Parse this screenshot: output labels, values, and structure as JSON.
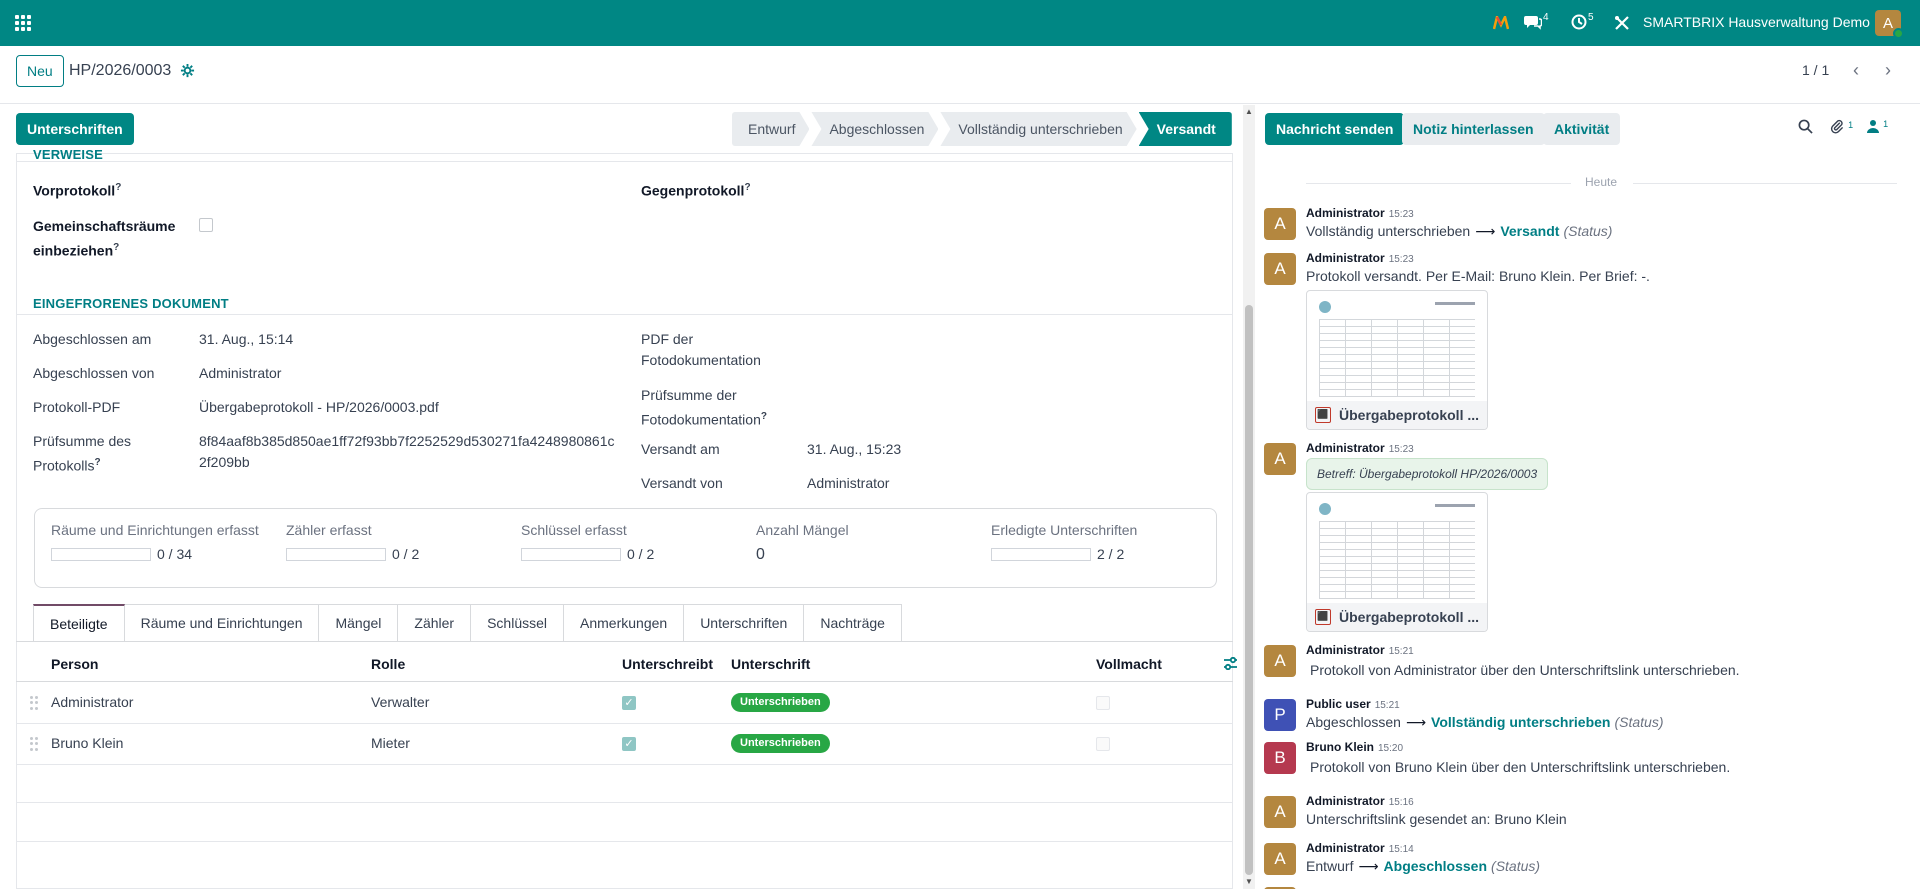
{
  "navbar": {
    "chat_count": "4",
    "activity_count": "5",
    "company": "SMARTBRIX Hausverwaltung Demo",
    "user_initial": "A"
  },
  "control_panel": {
    "new_label": "Neu",
    "record_name": "HP/2026/0003",
    "pager": "1 / 1"
  },
  "statusbar": {
    "action_label": "Unterschriften",
    "stages": [
      "Entwurf",
      "Abgeschlossen",
      "Vollständig unterschrieben",
      "Versandt"
    ],
    "active_stage": "Versandt"
  },
  "verweise": {
    "section_title": "VERWEISE",
    "vorprotokoll_label": "Vorprotokoll",
    "gegenprotokoll_label": "Gegenprotokoll",
    "gemeinschaft_label_1": "Gemeinschaftsräume",
    "gemeinschaft_label_2": "einbeziehen",
    "help_mark": "?"
  },
  "frozen": {
    "section_title": "EINGEFRORENES DOKUMENT",
    "abgeschlossen_am_label": "Abgeschlossen am",
    "abgeschlossen_am_value": "31. Aug., 15:14",
    "abgeschlossen_von_label": "Abgeschlossen von",
    "abgeschlossen_von_value": "Administrator",
    "protokoll_pdf_label": "Protokoll-PDF",
    "protokoll_pdf_value": "Übergabeprotokoll - HP/2026/0003.pdf",
    "pruefsumme_label_1": "Prüfsumme des",
    "pruefsumme_label_2": "Protokolls",
    "pruefsumme_value_1": "8f84aaf8b385d850ae1ff72f93bb7f2252529d530271fa4248980861c",
    "pruefsumme_value_2": "2f209bb",
    "pdf_foto_label_1": "PDF der",
    "pdf_foto_label_2": "Fotodokumentation",
    "pruef_foto_label_1": "Prüfsumme der",
    "pruef_foto_label_2": "Fotodokumentation",
    "versandt_am_label": "Versandt am",
    "versandt_am_value": "31. Aug., 15:23",
    "versandt_von_label": "Versandt von",
    "versandt_von_value": "Administrator"
  },
  "stats": [
    {
      "label": "Räume und Einrichtungen erfasst",
      "text": "0 / 34",
      "progress": 0
    },
    {
      "label": "Zähler erfasst",
      "text": "0 / 2",
      "progress": 0
    },
    {
      "label": "Schlüssel erfasst",
      "text": "0 / 2",
      "progress": 0
    },
    {
      "label": "Anzahl Mängel",
      "text": "0"
    },
    {
      "label": "Erledigte Unterschriften",
      "text": "2 / 2",
      "progress": 0
    }
  ],
  "tabs": [
    "Beteiligte",
    "Räume und Einrichtungen",
    "Mängel",
    "Zähler",
    "Schlüssel",
    "Anmerkungen",
    "Unterschriften",
    "Nachträge"
  ],
  "table": {
    "headers": [
      "Person",
      "Rolle",
      "Unterschreibt",
      "Unterschrift",
      "Vollmacht"
    ],
    "rows": [
      {
        "person": "Administrator",
        "rolle": "Verwalter",
        "unterschreibt": true,
        "unterschrift": "Unterschrieben",
        "vollmacht": false
      },
      {
        "person": "Bruno Klein",
        "rolle": "Mieter",
        "unterschreibt": true,
        "unterschrift": "Unterschrieben",
        "vollmacht": false
      }
    ]
  },
  "chatter": {
    "send_label": "Nachricht senden",
    "note_label": "Notiz hinterlassen",
    "activity_label": "Aktivität",
    "attachments_count": "1",
    "followers_count": "1",
    "today_label": "Heute",
    "messages": [
      {
        "initial": "A",
        "author": "Administrator",
        "time": "15:23",
        "old": "Vollständig unterschrieben",
        "arrow": "⟶",
        "new": "Versandt",
        "field": "(Status)",
        "color": "#b4873f"
      },
      {
        "initial": "A",
        "author": "Administrator",
        "time": "15:23",
        "text": "Protokoll versandt. Per E-Mail: Bruno Klein. Per Brief: -.",
        "attachment": "Übergabeprotokoll ...",
        "color": "#b4873f"
      },
      {
        "initial": "A",
        "author": "Administrator",
        "time": "15:23",
        "email": "Betreff: Übergabeprotokoll HP/2026/0003",
        "attachment": "Übergabeprotokoll ...",
        "color": "#b4873f"
      },
      {
        "initial": "A",
        "author": "Administrator",
        "time": "15:21",
        "text": "Protokoll von Administrator über den Unterschriftslink unterschrieben.",
        "color": "#b4873f"
      },
      {
        "initial": "P",
        "author": "Public user",
        "time": "15:21",
        "old": "Abgeschlossen",
        "arrow": "⟶",
        "new": "Vollständig unterschrieben",
        "field": "(Status)",
        "color": "#3f51b5"
      },
      {
        "initial": "B",
        "author": "Bruno Klein",
        "time": "15:20",
        "text": "Protokoll von Bruno Klein über den Unterschriftslink unterschrieben.",
        "color": "#b5394f"
      },
      {
        "initial": "A",
        "author": "Administrator",
        "time": "15:16",
        "text": "Unterschriftslink gesendet an: Bruno Klein",
        "color": "#b4873f"
      },
      {
        "initial": "A",
        "author": "Administrator",
        "time": "15:14",
        "old": "Entwurf",
        "arrow": "⟶",
        "new": "Abgeschlossen",
        "field": "(Status)",
        "color": "#b4873f"
      }
    ]
  },
  "colors": {
    "brand": "#008784",
    "link": "#017e84",
    "badge_success": "#28a745",
    "tab_active": "#714b67"
  },
  "icons": {
    "apps": "apps-grid-icon",
    "gear": "gear-icon",
    "search": "search-icon",
    "paperclip": "paperclip-icon",
    "followers": "user-icon"
  }
}
